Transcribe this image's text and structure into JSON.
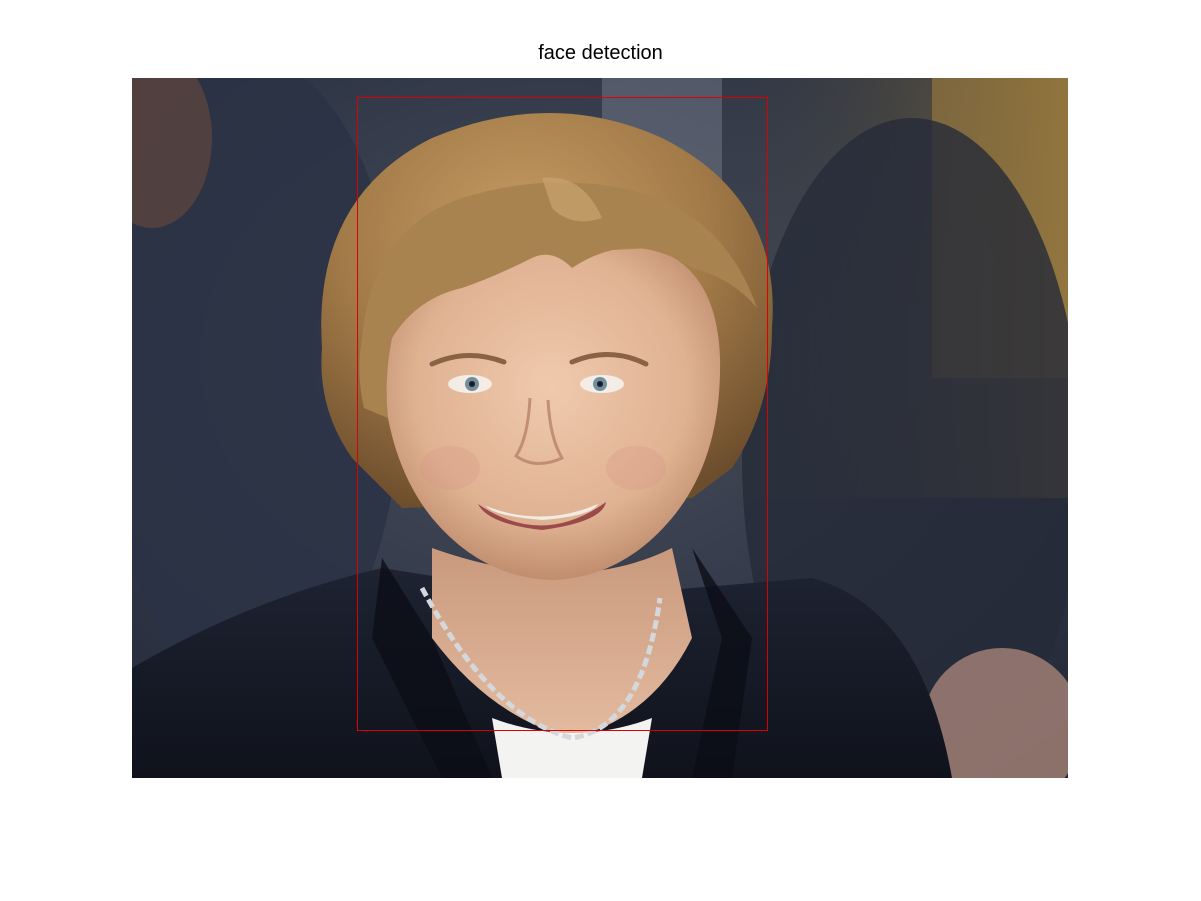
{
  "figure": {
    "title": "face detection"
  },
  "detection": {
    "box_color": "#dd0000"
  },
  "colors": {
    "background": "#ffffff",
    "backdrop_dark": "#2e3547",
    "hair": "#a07c4c",
    "skin": "#e0b497",
    "jacket": "#141826",
    "shirt": "#f2f2f0"
  }
}
